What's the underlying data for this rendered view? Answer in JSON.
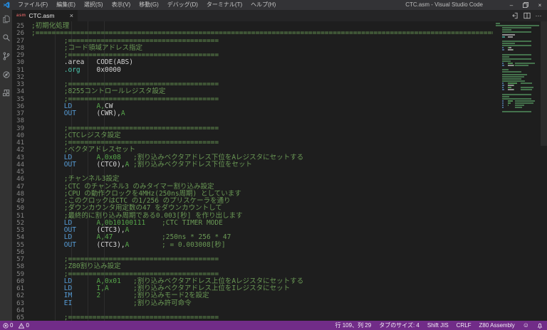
{
  "colors": {
    "statusbar": "#712c88",
    "comment": "#6A9955",
    "keyword": "#569CD6",
    "operand": "#57A64A",
    "plain": "#D4D4D4",
    "teal": "#4EC9B0",
    "accent_blue": "#2486d8",
    "asm_icon_red": "#C75C5C"
  },
  "window": {
    "title": "CTC.asm - Visual Studio Code",
    "minimize_glyph": "–",
    "close_glyph": "×"
  },
  "menu": {
    "items": [
      "ファイル(F)",
      "編集(E)",
      "選択(S)",
      "表示(V)",
      "移動(G)",
      "デバッグ(D)",
      "ターミナル(T)",
      "ヘルプ(H)"
    ]
  },
  "tab": {
    "icon_label": "asm",
    "label": "CTC.asm",
    "close_glyph": "×",
    "more_actions_glyph": "···"
  },
  "status_bar": {
    "errors": "0",
    "warnings": "0",
    "right": [
      "行 109、列 29",
      "タブのサイズ: 4",
      "Shift JIS",
      "CRLF",
      "Z80 Assembly"
    ],
    "smiley_glyph": "☺"
  },
  "editor": {
    "lines": [
      {
        "n": 25,
        "s": [
          [
            "c",
            ";初期化処理"
          ]
        ]
      },
      {
        "n": 26,
        "s": [
          [
            "c",
            ";=================================================================================================================="
          ]
        ]
      },
      {
        "n": 27,
        "s": [
          [
            "c",
            "        ;====================================="
          ]
        ]
      },
      {
        "n": 28,
        "s": [
          [
            "c",
            "        ;コード領域アドレス指定"
          ]
        ]
      },
      {
        "n": 29,
        "s": [
          [
            "c",
            "        ;====================================="
          ]
        ]
      },
      {
        "n": 30,
        "s": [
          [
            "w",
            "        .area   CODE(ABS)"
          ]
        ]
      },
      {
        "n": 31,
        "s": [
          [
            "w",
            "        "
          ],
          [
            "t",
            ".org"
          ],
          [
            "w",
            "    0x0000"
          ]
        ]
      },
      {
        "n": 32,
        "s": []
      },
      {
        "n": 33,
        "s": [
          [
            "c",
            "        ;====================================="
          ]
        ]
      },
      {
        "n": 34,
        "s": [
          [
            "c",
            "        ;8255コントロールレジスタ設定"
          ]
        ]
      },
      {
        "n": 35,
        "s": [
          [
            "c",
            "        ;====================================="
          ]
        ]
      },
      {
        "n": 36,
        "s": [
          [
            "k",
            "        LD"
          ],
          [
            "w",
            "      "
          ],
          [
            "o",
            "A,"
          ],
          [
            "w",
            "CW"
          ]
        ]
      },
      {
        "n": 37,
        "s": [
          [
            "k",
            "        OUT"
          ],
          [
            "w",
            "     (CWR),"
          ],
          [
            "o",
            "A"
          ]
        ]
      },
      {
        "n": 38,
        "s": []
      },
      {
        "n": 39,
        "s": [
          [
            "c",
            "        ;====================================="
          ]
        ]
      },
      {
        "n": 40,
        "s": [
          [
            "c",
            "        ;CTCレジスタ設定"
          ]
        ]
      },
      {
        "n": 41,
        "s": [
          [
            "c",
            "        ;====================================="
          ]
        ]
      },
      {
        "n": 42,
        "s": [
          [
            "c",
            "        ;ベクタアドレスセット"
          ]
        ]
      },
      {
        "n": 43,
        "s": [
          [
            "k",
            "        LD"
          ],
          [
            "w",
            "      "
          ],
          [
            "o",
            "A,0x08"
          ],
          [
            "c",
            "   ;割り込みベクタアドレス下位をAレジスタにセットする"
          ]
        ]
      },
      {
        "n": 44,
        "s": [
          [
            "k",
            "        OUT"
          ],
          [
            "w",
            "     (CTC0),"
          ],
          [
            "o",
            "A"
          ],
          [
            "c",
            " ;割り込みベクタアドレス下位をセット"
          ]
        ]
      },
      {
        "n": 45,
        "s": []
      },
      {
        "n": 46,
        "s": [
          [
            "c",
            "        ;チャンネル3設定"
          ]
        ]
      },
      {
        "n": 47,
        "s": [
          [
            "c",
            "        ;CTC のチャンネル3 のみタイマー割り込み設定"
          ]
        ]
      },
      {
        "n": 48,
        "s": [
          [
            "c",
            "        ;CPU の動作クロックを4MHz(250ns周期) としています"
          ]
        ]
      },
      {
        "n": 49,
        "s": [
          [
            "c",
            "        ;このクロックはCTC の1/256 のプリスケーラを通り"
          ]
        ]
      },
      {
        "n": 50,
        "s": [
          [
            "c",
            "        ;ダウンカウンタ用定数の47 をダウンカウントして"
          ]
        ]
      },
      {
        "n": 51,
        "s": [
          [
            "c",
            "        ;最終的に割り込み周期である0.003[秒] を作り出します"
          ]
        ]
      },
      {
        "n": 52,
        "s": [
          [
            "k",
            "        LD"
          ],
          [
            "w",
            "      "
          ],
          [
            "o",
            "A,0b10100111"
          ],
          [
            "c",
            "    ;CTC TIMER MODE"
          ]
        ]
      },
      {
        "n": 53,
        "s": [
          [
            "k",
            "        OUT"
          ],
          [
            "w",
            "     (CTC3),"
          ],
          [
            "o",
            "A"
          ]
        ]
      },
      {
        "n": 54,
        "s": [
          [
            "k",
            "        LD"
          ],
          [
            "w",
            "      "
          ],
          [
            "o",
            "A,47"
          ],
          [
            "c",
            "            ;250ns * 256 * 47"
          ]
        ]
      },
      {
        "n": 55,
        "s": [
          [
            "k",
            "        OUT"
          ],
          [
            "w",
            "     (CTC3),"
          ],
          [
            "o",
            "A"
          ],
          [
            "c",
            "        ; = 0.003008[秒]"
          ]
        ]
      },
      {
        "n": 56,
        "s": []
      },
      {
        "n": 57,
        "s": [
          [
            "c",
            "        ;====================================="
          ]
        ]
      },
      {
        "n": 58,
        "s": [
          [
            "c",
            "        ;Z80割り込み設定"
          ]
        ]
      },
      {
        "n": 59,
        "s": [
          [
            "c",
            "        ;====================================="
          ]
        ]
      },
      {
        "n": 60,
        "s": [
          [
            "k",
            "        LD"
          ],
          [
            "w",
            "      "
          ],
          [
            "o",
            "A,0x01"
          ],
          [
            "c",
            "   ;割り込みベクタアドレス上位をAレジスタにセットする"
          ]
        ]
      },
      {
        "n": 61,
        "s": [
          [
            "k",
            "        LD"
          ],
          [
            "w",
            "      "
          ],
          [
            "o",
            "I,A"
          ],
          [
            "c",
            "      ;割り込みベクタアドレス上位をIレジスタにセット"
          ]
        ]
      },
      {
        "n": 62,
        "s": [
          [
            "k",
            "        IM"
          ],
          [
            "w",
            "      "
          ],
          [
            "o",
            "2"
          ],
          [
            "c",
            "        ;割り込みモード2を設定"
          ]
        ]
      },
      {
        "n": 63,
        "s": [
          [
            "k",
            "        EI"
          ],
          [
            "c",
            "               ;割り込み許可命令"
          ]
        ]
      },
      {
        "n": 64,
        "s": []
      },
      {
        "n": 65,
        "s": [
          [
            "c",
            "        ;====================================="
          ]
        ]
      }
    ]
  }
}
